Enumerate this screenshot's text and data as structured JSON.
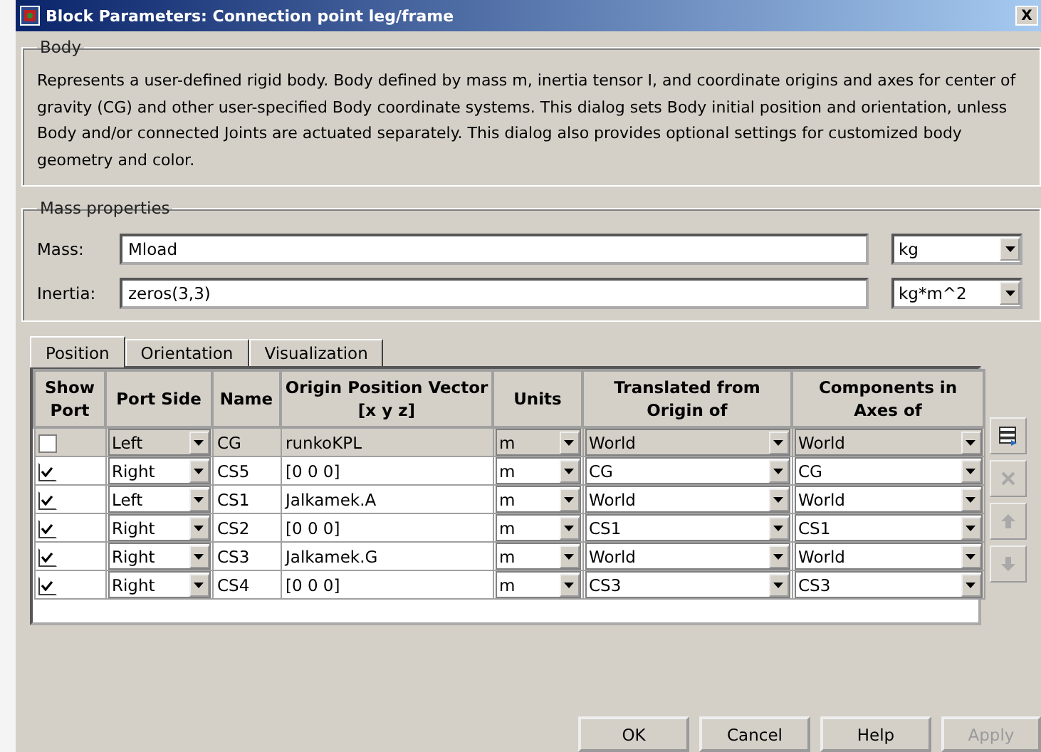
{
  "window": {
    "title": "Block Parameters: Connection point leg/frame",
    "close": "X"
  },
  "body": {
    "legend": "Body",
    "description": "Represents a user-defined rigid body. Body defined by mass m, inertia tensor I, and coordinate origins and axes for center of gravity (CG) and other user-specified Body coordinate systems. This dialog sets Body initial position and orientation, unless Body and/or connected Joints are actuated separately. This dialog also provides optional settings for customized body geometry and color."
  },
  "mass_properties": {
    "legend": "Mass properties",
    "fields": [
      {
        "label": "Mass:",
        "value": "Mload",
        "unit": "kg"
      },
      {
        "label": "Inertia:",
        "value": "zeros(3,3)",
        "unit": "kg*m^2"
      }
    ]
  },
  "tabs": [
    {
      "label": "Position",
      "selected": true
    },
    {
      "label": "Orientation",
      "selected": false
    },
    {
      "label": "Visualization",
      "selected": false
    }
  ],
  "table": {
    "columns": [
      "Show Port",
      "Port Side",
      "Name",
      "Origin Position Vector [x y z]",
      "Units",
      "Translated from Origin of",
      "Components in Axes of"
    ],
    "rows": [
      {
        "show_port": false,
        "selected": true,
        "port_side": "Left",
        "name": "CG",
        "vector": "runkoKPL",
        "units": "m",
        "translated_from": "World",
        "axes_of": "World"
      },
      {
        "show_port": true,
        "selected": false,
        "port_side": "Right",
        "name": "CS5",
        "vector": "[0 0 0]",
        "units": "m",
        "translated_from": "CG",
        "axes_of": "CG"
      },
      {
        "show_port": true,
        "selected": false,
        "port_side": "Left",
        "name": "CS1",
        "vector": "Jalkamek.A",
        "units": "m",
        "translated_from": "World",
        "axes_of": "World"
      },
      {
        "show_port": true,
        "selected": false,
        "port_side": "Right",
        "name": "CS2",
        "vector": "[0 0 0]",
        "units": "m",
        "translated_from": "CS1",
        "axes_of": "CS1"
      },
      {
        "show_port": true,
        "selected": false,
        "port_side": "Right",
        "name": "CS3",
        "vector": "Jalkamek.G",
        "units": "m",
        "translated_from": "World",
        "axes_of": "World"
      },
      {
        "show_port": true,
        "selected": false,
        "port_side": "Right",
        "name": "CS4",
        "vector": "[0 0 0]",
        "units": "m",
        "translated_from": "CS3",
        "axes_of": "CS3"
      }
    ]
  },
  "side_buttons": [
    {
      "kind": "add",
      "disabled": false
    },
    {
      "kind": "delete",
      "disabled": true
    },
    {
      "kind": "up",
      "disabled": true
    },
    {
      "kind": "down",
      "disabled": true
    }
  ],
  "buttons": [
    {
      "label": "OK",
      "disabled": false
    },
    {
      "label": "Cancel",
      "disabled": false
    },
    {
      "label": "Help",
      "disabled": false
    },
    {
      "label": "Apply",
      "disabled": true
    }
  ]
}
